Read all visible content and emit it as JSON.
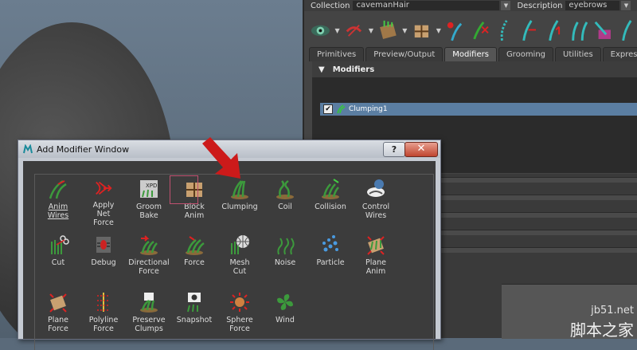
{
  "header": {
    "collection_label": "Collection",
    "collection_value": "cavemanHair",
    "description_label": "Description",
    "description_value": "eyebrows"
  },
  "tabs": [
    "Primitives",
    "Preview/Output",
    "Modifiers",
    "Grooming",
    "Utilities",
    "Expressions"
  ],
  "modifiers_panel": {
    "section_title": "Modifiers",
    "items": [
      {
        "name": "Clumping1",
        "checked": true
      }
    ]
  },
  "dialog": {
    "title": "Add Modifier Window",
    "help_label": "?",
    "close_label": "✕",
    "modifiers": [
      {
        "label": "Anim\nWires",
        "icon": "anim-wires-icon"
      },
      {
        "label": "Apply\nNet\nForce",
        "icon": "apply-net-force-icon"
      },
      {
        "label": "Groom\nBake",
        "icon": "groom-bake-icon"
      },
      {
        "label": "Block\nAnim",
        "icon": "block-anim-icon"
      },
      {
        "label": "Clumping",
        "icon": "clumping-icon"
      },
      {
        "label": "Coil",
        "icon": "coil-icon"
      },
      {
        "label": "Collision",
        "icon": "collision-icon"
      },
      {
        "label": "Control\nWires",
        "icon": "control-wires-icon"
      },
      {
        "label": "Cut",
        "icon": "cut-icon"
      },
      {
        "label": "Debug",
        "icon": "debug-icon"
      },
      {
        "label": "Directional\nForce",
        "icon": "directional-force-icon"
      },
      {
        "label": "Force",
        "icon": "force-icon"
      },
      {
        "label": "Mesh\nCut",
        "icon": "mesh-cut-icon"
      },
      {
        "label": "Noise",
        "icon": "noise-icon"
      },
      {
        "label": "Particle",
        "icon": "particle-icon"
      },
      {
        "label": "Plane\nAnim",
        "icon": "plane-anim-icon"
      },
      {
        "label": "Plane\nForce",
        "icon": "plane-force-icon"
      },
      {
        "label": "Polyline\nForce",
        "icon": "polyline-force-icon"
      },
      {
        "label": "Preserve\nClumps",
        "icon": "preserve-clumps-icon"
      },
      {
        "label": "Snapshot",
        "icon": "snapshot-icon"
      },
      {
        "label": "Sphere\nForce",
        "icon": "sphere-force-icon"
      },
      {
        "label": "Wind",
        "icon": "wind-icon"
      }
    ]
  },
  "watermark": {
    "site": "jb51.net",
    "name": "脚本之家"
  },
  "colors": {
    "accent_red": "#cc1a1a",
    "selection_blue": "#5b7ea2",
    "grass_green": "#3c9a3c"
  }
}
